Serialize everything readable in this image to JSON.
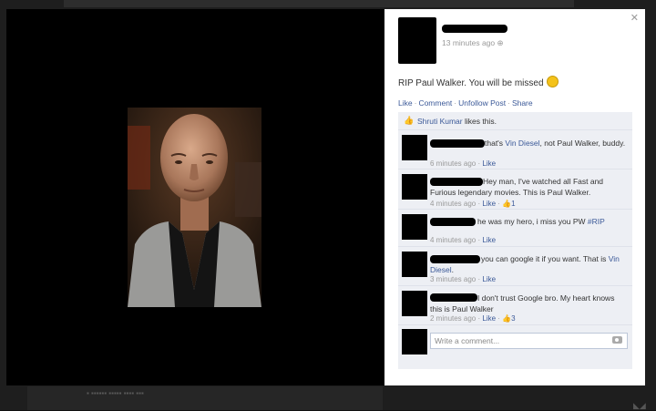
{
  "post": {
    "timestamp": "13 minutes ago",
    "text": "RIP Paul Walker. You will be missed",
    "actions": [
      "Like",
      "Comment",
      "Unfollow Post",
      "Share"
    ]
  },
  "likes": {
    "name": "Shruti Kumar",
    "suffix": " likes this."
  },
  "comments": [
    {
      "text_pre": "that's ",
      "text_link": "Vin Diesel",
      "text_post": ", not Paul Walker, buddy.",
      "time": "6 minutes ago",
      "like": "Like",
      "like_count": ""
    },
    {
      "text_pre": "Hey man, I've watched all Fast and Furious legendary movies. This is Paul Walker.",
      "text_link": "",
      "text_post": "",
      "time": "4 minutes ago",
      "like": "Like",
      "like_count": "1"
    },
    {
      "text_pre": "he was my hero, i miss you PW ",
      "text_link": "#RIP",
      "text_post": "",
      "time": "4 minutes ago",
      "like": "Like",
      "like_count": ""
    },
    {
      "text_pre": "you can google it if you want. That is ",
      "text_link": "Vin Diesel",
      "text_post": ".",
      "time": "3 minutes ago",
      "like": "Like",
      "like_count": ""
    },
    {
      "text_pre": "I don't trust Google bro. My heart knows this is Paul Walker",
      "text_link": "",
      "text_post": "",
      "time": "2 minutes ago",
      "like": "Like",
      "like_count": "3"
    }
  ],
  "write_comment": {
    "placeholder": "Write a comment..."
  },
  "icons": {
    "close": "close-icon",
    "camera": "camera-icon",
    "thumb": "thumbs-up-icon",
    "smiley": "smiley-emoticon-icon"
  }
}
